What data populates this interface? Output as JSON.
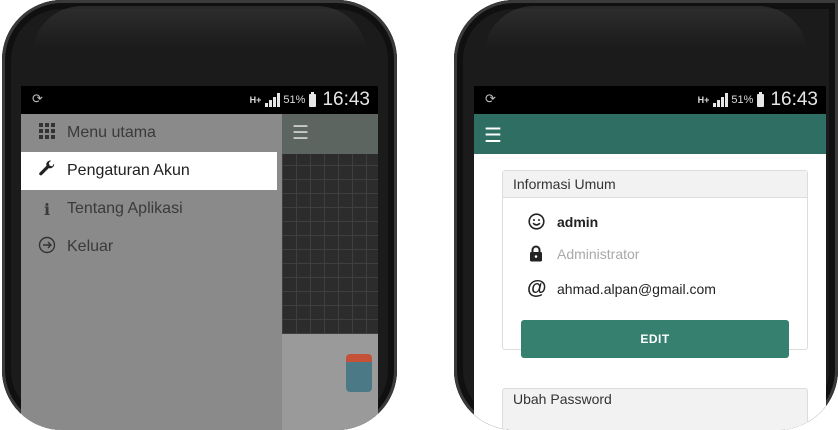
{
  "left_phone": {
    "status": {
      "network": "H+",
      "battery_pct": "51%",
      "time": "16:43"
    },
    "drawer": [
      {
        "label": "Menu utama",
        "icon": "grid-icon",
        "active": false
      },
      {
        "label": "Pengaturan Akun",
        "icon": "wrench-icon",
        "active": true
      },
      {
        "label": "Tentang Aplikasi",
        "icon": "info-icon",
        "active": false
      },
      {
        "label": "Keluar",
        "icon": "logout-icon",
        "active": false
      }
    ],
    "toolbar_icon": "menu-icon"
  },
  "right_phone": {
    "status": {
      "network": "H+",
      "battery_pct": "51%",
      "time": "16:43"
    },
    "appbar_icon": "menu-icon",
    "card": {
      "title": "Informasi Umum",
      "name": "admin",
      "role": "Administrator",
      "email": "ahmad.alpan@gmail.com",
      "edit_label": "EDIT"
    },
    "card2": {
      "title": "Ubah Password"
    },
    "colors": {
      "primary": "#2e6e63",
      "button": "#35806f"
    }
  }
}
